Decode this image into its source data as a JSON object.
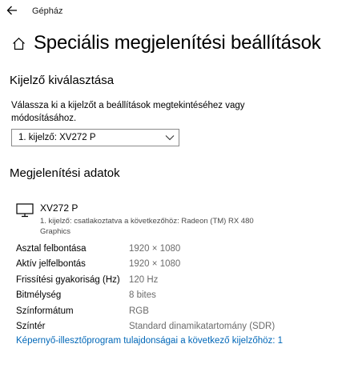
{
  "window": {
    "app_title": "Gépház"
  },
  "page": {
    "title": "Speciális megjelenítési beállítások"
  },
  "select_display": {
    "heading": "Kijelző kiválasztása",
    "description": "Válassza ki a kijelzőt a beállítások megtekintéséhez vagy módosításához.",
    "selected": "1. kijelző: XV272 P"
  },
  "display_info": {
    "heading": "Megjelenítési adatok",
    "monitor_name": "XV272 P",
    "monitor_sub": "1. kijelző: csatlakoztatva a következőhöz: Radeon (TM) RX 480 Graphics",
    "rows": [
      {
        "label": "Asztal felbontása",
        "value": "1920 × 1080"
      },
      {
        "label": "Aktív jelfelbontás",
        "value": "1920 × 1080"
      },
      {
        "label": "Frissítési gyakoriság (Hz)",
        "value": "120 Hz"
      },
      {
        "label": "Bitmélység",
        "value": "8 bites"
      },
      {
        "label": "Színformátum",
        "value": "RGB"
      },
      {
        "label": "Színtér",
        "value": "Standard dinamikatartomány (SDR)"
      }
    ],
    "adapter_link": "Képernyő-illesztőprogram tulajdonságai a következő kijelzőhöz: 1"
  },
  "icons": {
    "back": "back-arrow-icon",
    "home": "home-icon",
    "dropdown": "chevron-down-icon",
    "monitor": "monitor-icon"
  },
  "colors": {
    "link": "#0067b8",
    "secondary_text": "#6b6b6b"
  }
}
